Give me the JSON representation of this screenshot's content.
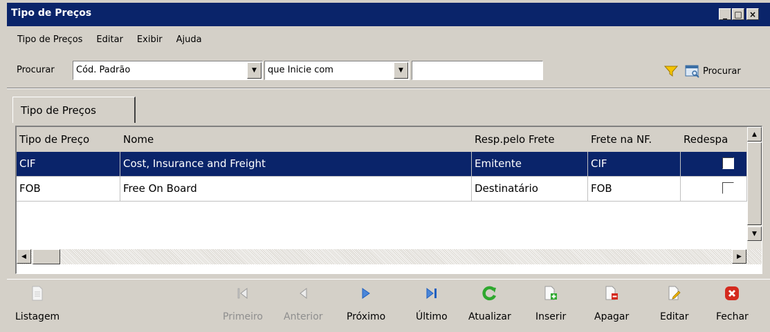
{
  "window": {
    "title": "Tipo de Preços",
    "controls": {
      "minimize": "_",
      "maximize": "□",
      "close": "×"
    }
  },
  "menu": {
    "items": [
      {
        "label": "Tipo de Preços"
      },
      {
        "label": "Editar"
      },
      {
        "label": "Exibir"
      },
      {
        "label": "Ajuda"
      }
    ]
  },
  "search": {
    "label": "Procurar",
    "field_value": "Cód. Padrão",
    "mode_value": "que Inicie com",
    "query_value": "",
    "button_label": "Procurar"
  },
  "tab": {
    "label": "Tipo de Preços"
  },
  "grid": {
    "columns": [
      "Tipo de Preço",
      "Nome",
      "Resp.pelo Frete",
      "Frete na NF.",
      "Redespa"
    ],
    "rows": [
      {
        "tipo": "CIF",
        "nome": "Cost, Insurance and Freight",
        "resp": "Emitente",
        "frete": "CIF",
        "redespacho": false,
        "selected": true
      },
      {
        "tipo": "FOB",
        "nome": "Free On Board",
        "resp": "Destinatário",
        "frete": "FOB",
        "redespacho": false,
        "selected": false
      }
    ]
  },
  "toolbar": {
    "listagem": "Listagem",
    "primeiro": "Primeiro",
    "anterior": "Anterior",
    "proximo": "Próximo",
    "ultimo": "Último",
    "atualizar": "Atualizar",
    "inserir": "Inserir",
    "apagar": "Apagar",
    "editar": "Editar",
    "fechar": "Fechar"
  },
  "colors": {
    "titlebar": "#0a246a",
    "selection": "#0a246a",
    "face": "#d4d0c8",
    "nav_blue": "#1f5fbf",
    "refresh_green": "#2fa82f",
    "close_red": "#d42a1e"
  }
}
